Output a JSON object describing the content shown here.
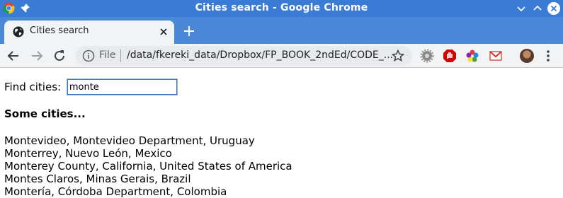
{
  "window": {
    "title": "Cities search - Google Chrome"
  },
  "tab": {
    "title": "Cities search"
  },
  "omnibox": {
    "scheme_label": "File",
    "url": "/data/fkereki_data/Dropbox/FP_BOOK_2ndEd/CODE_..."
  },
  "page": {
    "find_label": "Find cities:",
    "search_value": "monte",
    "heading": "Some cities...",
    "results": [
      "Montevideo, Montevideo Department, Uruguay",
      "Monterrey, Nuevo León, Mexico",
      "Monterey County, California, United States of America",
      "Montes Claros, Minas Gerais, Brazil",
      "Montería, Córdoba Department, Colombia"
    ]
  },
  "icons": {
    "app": "chrome-logo-icon",
    "pin": "pin-icon",
    "minimize": "minimize-icon",
    "maximize": "maximize-icon",
    "close": "close-icon",
    "favicon": "globe-icon",
    "tab_close": "close-icon",
    "new_tab": "plus-icon",
    "back": "back-arrow-icon",
    "forward": "forward-arrow-icon",
    "reload": "reload-icon",
    "site_info": "info-icon",
    "bookmark": "star-icon",
    "extensions": [
      "gear-extension-icon",
      "stop-hand-icon",
      "color-wheel-icon",
      "gmail-icon"
    ],
    "profile": "avatar-icon",
    "menu": "kebab-menu-icon"
  },
  "colors": {
    "titlebar": "#3a7bd5",
    "tabstrip": "#4b88d8",
    "toolbar": "#f1f3f4",
    "input_border": "#3b75c8"
  }
}
